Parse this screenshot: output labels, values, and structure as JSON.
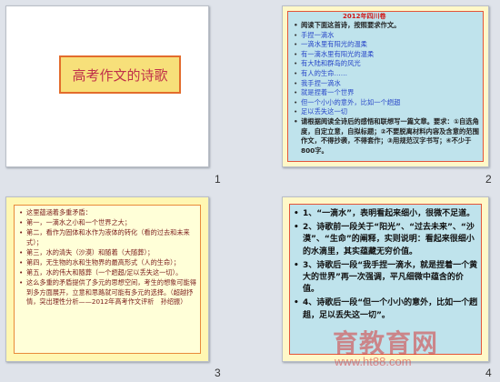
{
  "slides": [
    {
      "number": "1",
      "title": "高考作文的诗歌"
    },
    {
      "number": "2",
      "header": "2012年四川卷",
      "lines": [
        {
          "text": "阅读下面这首诗，按照要求作文。",
          "style": "blk"
        },
        {
          "text": "手捏一滴水",
          "style": "blue"
        },
        {
          "text": "一滴水里有阳光的温柔",
          "style": "blue"
        },
        {
          "text": "有一滴水里有阳光的温柔",
          "style": "blue"
        },
        {
          "text": "有大陆和群岛的风光",
          "style": "blue"
        },
        {
          "text": "有人的生命……",
          "style": "blue"
        },
        {
          "text": "我手捏一滴水",
          "style": "blue"
        },
        {
          "text": "就是捏着一个世界",
          "style": "blue"
        },
        {
          "text": "但一个小小的意外，比如一个趔趄",
          "style": "blue"
        },
        {
          "text": "足以丢失这一切",
          "style": "blue"
        },
        {
          "text": "请根据阅读全诗后的感悟和联想写一篇文章。要求：①自选角度，自定立意，自拟标题；②不要脱离材料内容及含意的范围作文，不得抄袭，不得套作；③用规范汉字书写；④不少于800字。",
          "style": "blk"
        }
      ]
    },
    {
      "number": "3",
      "lines": [
        "这里蕴涵着多重矛盾：",
        "第一，一滴水之小和一个世界之大；",
        "第二，看作为固体和水作为液体的转化（看的过去和未来式）；",
        "第三，水的清失（沙漠）和随着（大随葬）；",
        "第四，无生物的水和生物界的最高形式（人的生命）；",
        "第五，水的伟大和随葬（一个趔趄/足以丢失这一切）。",
        "这么多重的矛盾提供了多元的思想空间，考生的想象可能得到多方面展开，立意和思路就可能有多元的选择。（超越抒情，突出理性分析——2012年高考作文评析　孙绍振）"
      ]
    },
    {
      "number": "4",
      "lines": [
        "1、“一滴水”，表明看起来细小，很微不足道。",
        "2、诗歌前一段关于“阳光”、“过去未来”、“沙漠”、“生命”的阐释，实则说明：看起来很细小的水滴里，其实蕴藏无穷价值。",
        "3、诗歌后一段“我手捏一滴水，就是捏着一个黄大的世界”再一次强调，平凡细微中蕴含的价值。",
        "4、诗歌后一段“但一个小小的意外，比如一个趔趄，足以丢失这一切”。"
      ]
    }
  ],
  "watermark": {
    "site_name": "育教育网",
    "url": "www.ht88.com"
  }
}
